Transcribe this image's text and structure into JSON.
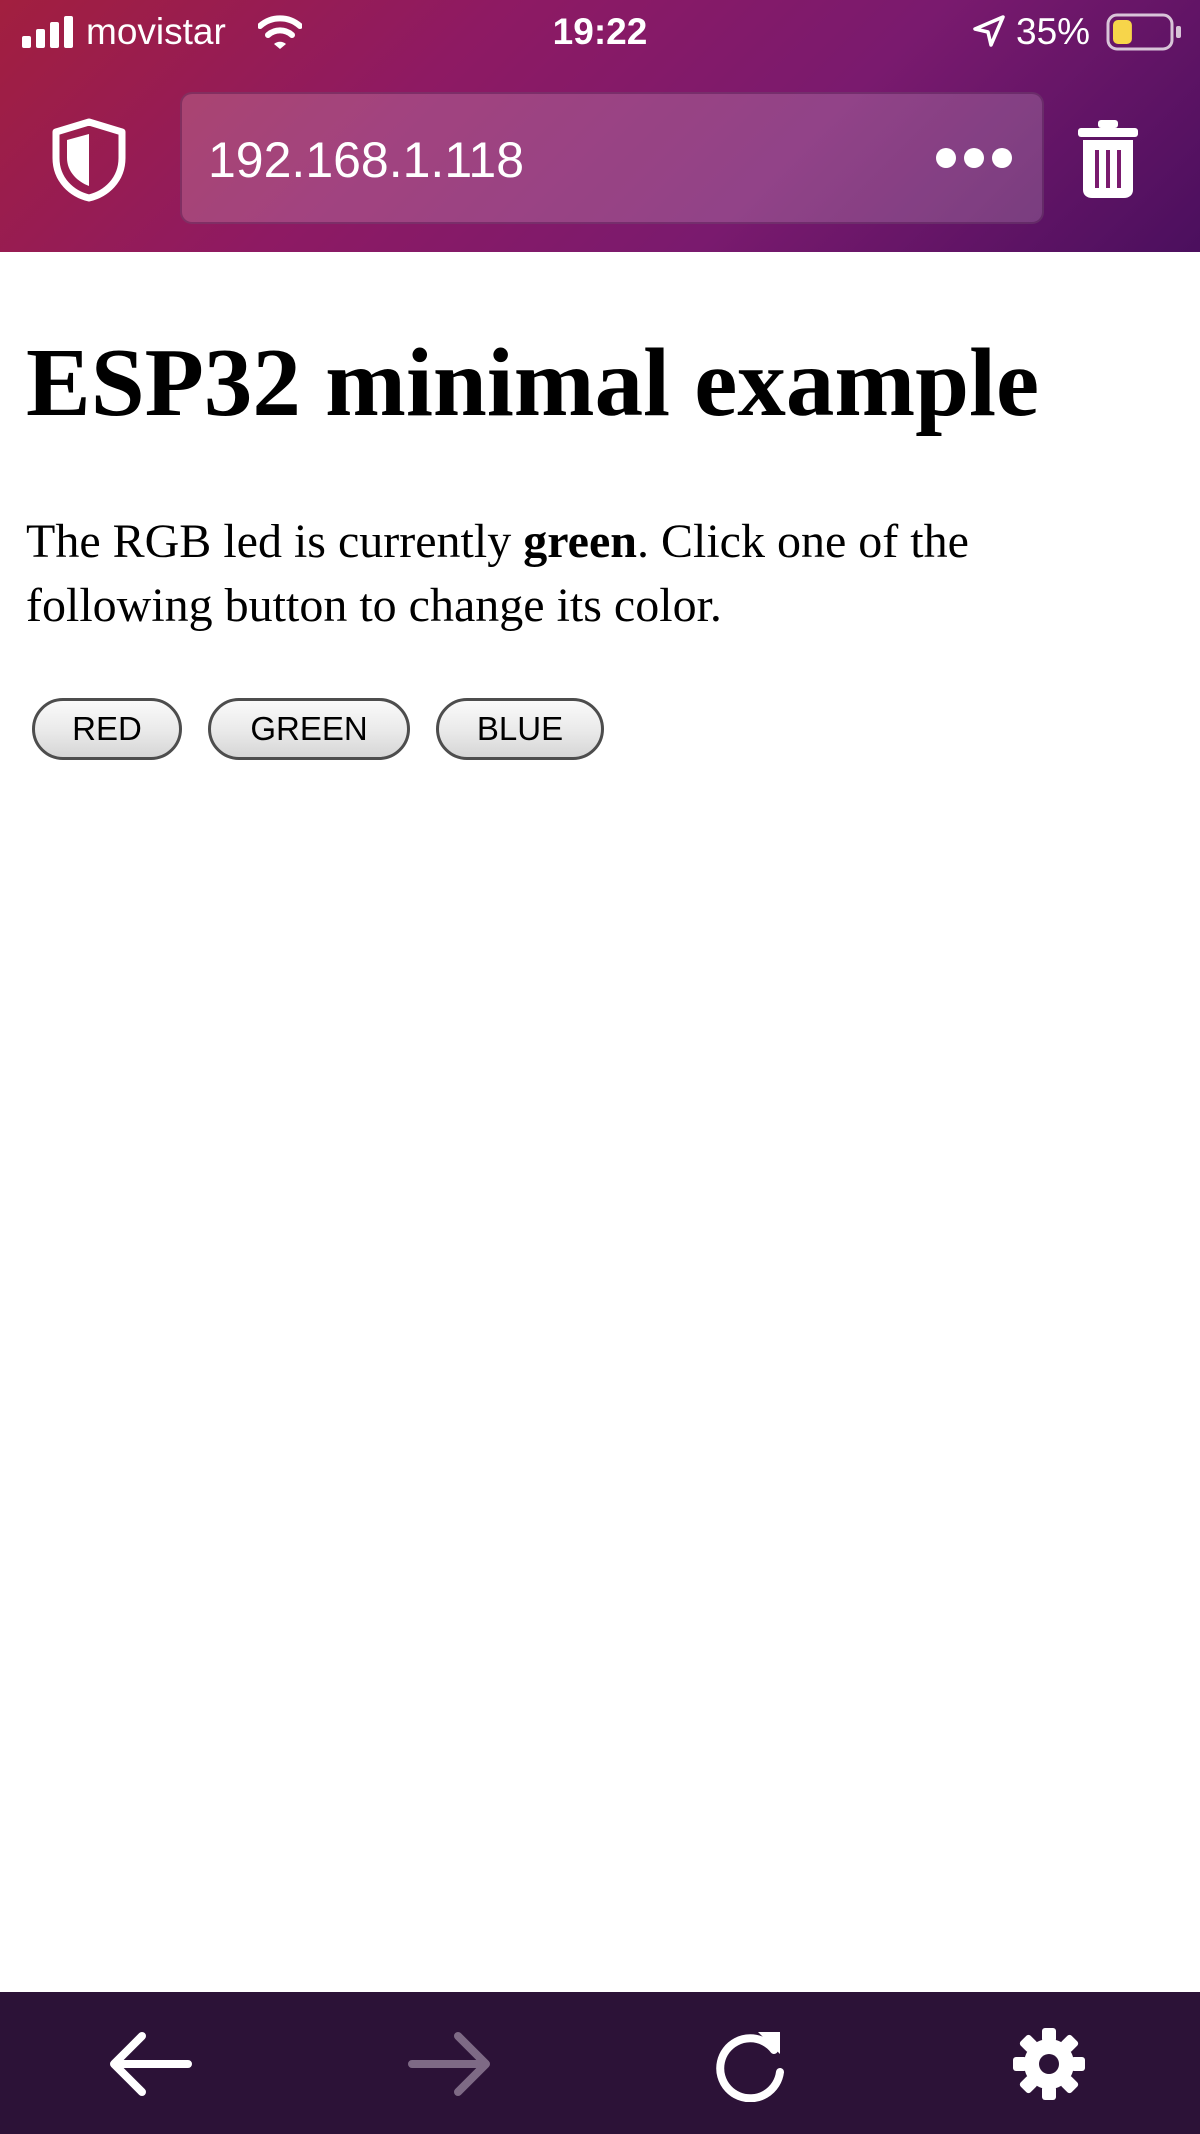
{
  "status_bar": {
    "carrier": "movistar",
    "time": "19:22",
    "battery_percent": "35%",
    "battery_level": 0.35,
    "battery_color": "#f7d54a",
    "icons": [
      "signal-icon",
      "wifi-icon",
      "location-icon",
      "battery-icon"
    ]
  },
  "toolbar": {
    "url": "192.168.1.118",
    "icons": [
      "shield-icon",
      "more-icon",
      "trash-icon"
    ],
    "gradient_colors": [
      "#a21f3f",
      "#8e1a63",
      "#4b0f5e"
    ]
  },
  "page": {
    "title": "ESP32 minimal example",
    "paragraph_before": "The RGB led is currently ",
    "current_color": "green",
    "paragraph_after": ". Click one of the following button to change its color.",
    "buttons": [
      "RED",
      "GREEN",
      "BLUE"
    ]
  },
  "bottom_bar": {
    "background": "#2c1237",
    "icons": [
      "back-icon",
      "forward-icon",
      "reload-icon",
      "settings-icon"
    ],
    "forward_enabled": false
  }
}
